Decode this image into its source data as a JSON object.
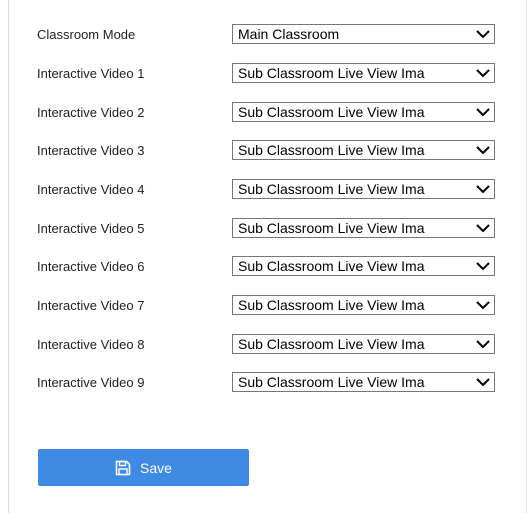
{
  "form": {
    "rows": [
      {
        "label": "Classroom Mode",
        "value": "Main Classroom"
      },
      {
        "label": "Interactive Video 1",
        "value": "Sub Classroom Live View Ima"
      },
      {
        "label": "Interactive Video 2",
        "value": "Sub Classroom Live View Ima"
      },
      {
        "label": "Interactive Video 3",
        "value": "Sub Classroom Live View Ima"
      },
      {
        "label": "Interactive Video 4",
        "value": "Sub Classroom Live View Ima"
      },
      {
        "label": "Interactive Video 5",
        "value": "Sub Classroom Live View Ima"
      },
      {
        "label": "Interactive Video 6",
        "value": "Sub Classroom Live View Ima"
      },
      {
        "label": "Interactive Video 7",
        "value": "Sub Classroom Live View Ima"
      },
      {
        "label": "Interactive Video 8",
        "value": "Sub Classroom Live View Ima"
      },
      {
        "label": "Interactive Video 9",
        "value": "Sub Classroom Live View Ima"
      }
    ]
  },
  "actions": {
    "save_label": "Save",
    "save_icon": "floppy-disk-icon",
    "save_color": "#3f8ae3"
  }
}
